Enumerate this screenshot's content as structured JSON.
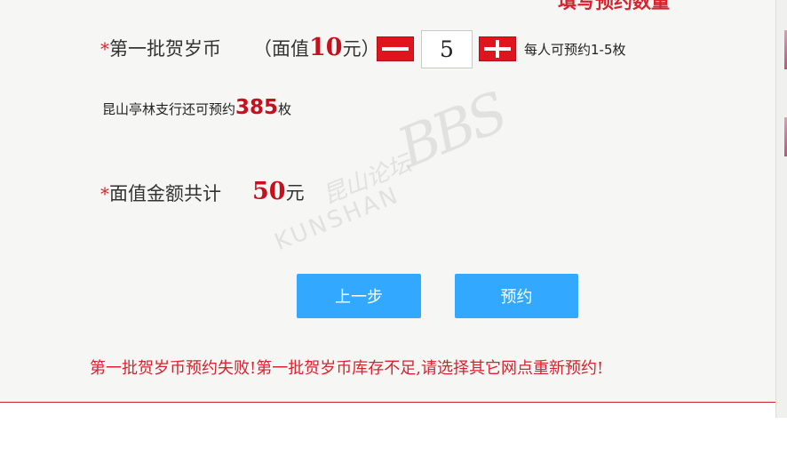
{
  "header": {
    "title_cut": "填写预约数量"
  },
  "row1": {
    "asterisk": "*",
    "label": "第一批贺岁币",
    "face_prefix": "（面值",
    "face_value": "10",
    "face_suffix": "元）",
    "quantity": "5",
    "limit_text": "每人可预约1-5枚"
  },
  "remaining": {
    "prefix": "昆山亭林支行还可预约",
    "count": "385",
    "suffix": "枚"
  },
  "total": {
    "asterisk": "*",
    "label": "面值金额共计",
    "amount": "50",
    "unit": "元"
  },
  "buttons": {
    "prev": "上一步",
    "submit": "预约"
  },
  "error_message": "第一批贺岁币预约失败!第一批贺岁币库存不足,请选择其它网点重新预约!",
  "watermark": {
    "cn": "昆山论坛",
    "en": "KUNSHAN",
    "bbs": "BBS"
  },
  "colors": {
    "accent_red": "#d6232e",
    "button_blue": "#33a8ff",
    "panel_bg": "#f6f6f4"
  }
}
